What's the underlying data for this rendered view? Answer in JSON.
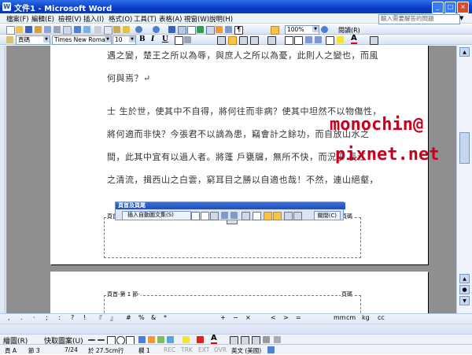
{
  "window": {
    "title": "文件1 - Microsoft Word"
  },
  "menu": {
    "items": [
      "檔案(F)",
      "編輯(E)",
      "檢視(V)",
      "插入(I)",
      "格式(O)",
      "工具(T)",
      "表格(A)",
      "視窗(W)",
      "說明(H)"
    ],
    "help_placeholder": "輸入需要解答的問題"
  },
  "toolbar": {
    "zoom": "100%",
    "reading": "閱讀(R)",
    "style": "頁碼",
    "font": "Times New Roman",
    "size": "10"
  },
  "document": {
    "lines": [
      "遇之變，楚王之所以為辱，與庶人之所以為憂，此則人之變也，而風",
      "何與焉？↵",
      "士 生於世，使其中不自得，將何往而非病？使其中坦然不以物傷性，",
      "將何適而非快？今張君不以謫為患，竊會計之餘功，而自放山水之",
      "間，此其中宜有以過人者。將蓬 戶甕牖，無所不快，而況乎 長江",
      "之清流，揖西山之白雲，窮耳目之勝以自適也哉！不然，連山絕壑，"
    ],
    "header_label": "頁首-第 1 節-",
    "header_right": "頁碼",
    "watermark": [
      "monochin@",
      "pixnet.net"
    ]
  },
  "hf_toolbar": {
    "title": "頁首及頁尾",
    "autotext": "插入自動圖文集(S)",
    "close": "關閉(C)"
  },
  "drawing": {
    "label": "繪圖(R)",
    "autoshapes": "快取圖案(U)"
  },
  "status": {
    "page": "頁 A",
    "section": "節 3",
    "pos": "7/24",
    "at": "於 27.5cm",
    "line": "行",
    "col": "欄 1",
    "rec": "REC",
    "trk": "TRK",
    "ext": "EXT",
    "ovr": "OVR",
    "lang": "英文 (美國)"
  }
}
